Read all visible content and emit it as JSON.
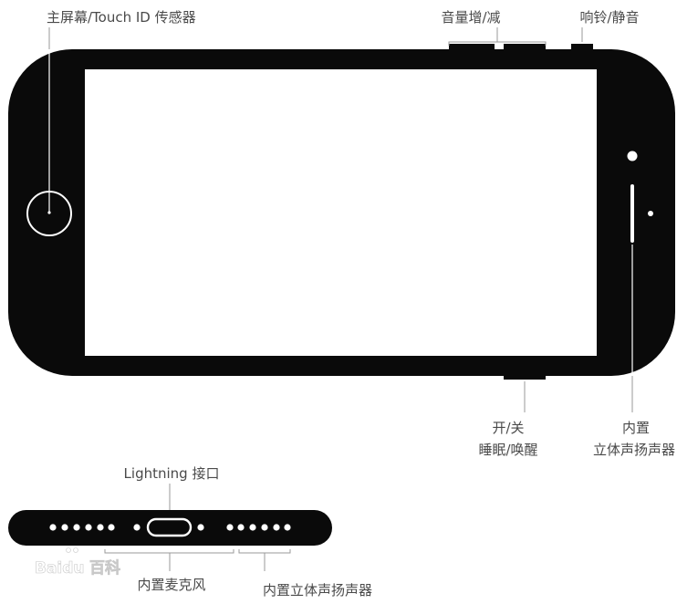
{
  "labels": {
    "home_button": "主屏幕/Touch ID 传感器",
    "volume": "音量增/减",
    "ring_silent": "响铃/静音",
    "power_line1": "开/关",
    "power_line2": "睡眠/唤醒",
    "speaker_side_line1": "内置",
    "speaker_side_line2": "立体声扬声器",
    "lightning": "Lightning 接口",
    "microphone": "内置麦克风",
    "speaker_bottom": "内置立体声扬声器"
  },
  "watermark": {
    "brand": "Baidu",
    "suffix": "百科"
  },
  "colors": {
    "device": "#0a0a0a",
    "screen": "#ffffff",
    "label": "#4a4a4a",
    "leader_line": "#9a9a9a"
  }
}
